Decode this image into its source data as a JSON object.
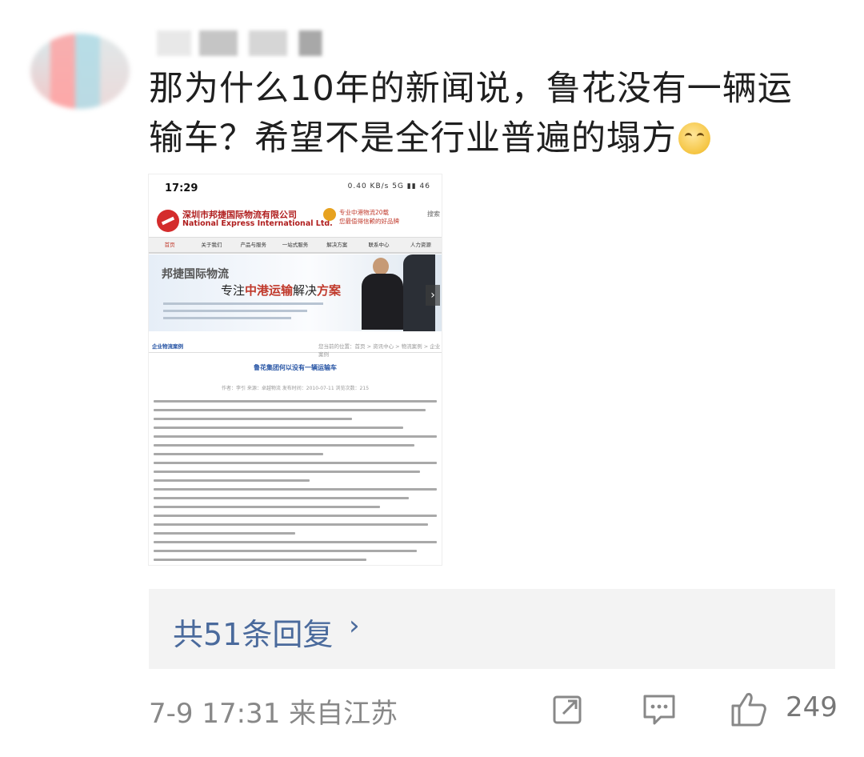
{
  "comment": {
    "text": "那为什么10年的新闻说，鲁花没有一辆运输车？希望不是全行业普遍的塌方"
  },
  "screenshot": {
    "status_time": "17:29",
    "status_icons": "0.40 KB/s 5G ▮▮ 46",
    "company_cn": "深圳市邦捷国际物流有限公司",
    "company_en": "National Express International Ltd.",
    "slogan_line1": "专业中港物流20载",
    "slogan_line2": "您最值得信赖的好品牌",
    "search": "搜索",
    "nav": [
      "首页",
      "关于我们",
      "产品与服务",
      "一站式服务",
      "解决方案",
      "联系中心",
      "人力资源"
    ],
    "banner_brand": "邦捷国际物流",
    "banner_slogan_a": "专注",
    "banner_slogan_b": "中港运输",
    "banner_slogan_c": "解决",
    "banner_slogan_d": "方案",
    "crumb_left": "企业物流案例",
    "crumb_right": "您当前的位置：首页 > 资讯中心 > 物流案例 > 企业案例",
    "article_title": "鲁花集团何以没有一辆运输车",
    "article_meta": "作者：李引   来源：卓越物流   发布时间：2010-07-11   浏览次数：215"
  },
  "replies": {
    "label": "共51条回复",
    "chevron": "›"
  },
  "footer": {
    "date_location": "7-9 17:31 来自江苏",
    "likes": "249"
  },
  "icons": {
    "share": "share-icon",
    "comment": "comment-icon",
    "like": "thumbs-up-icon",
    "emoji": "smile-emoji-icon"
  }
}
